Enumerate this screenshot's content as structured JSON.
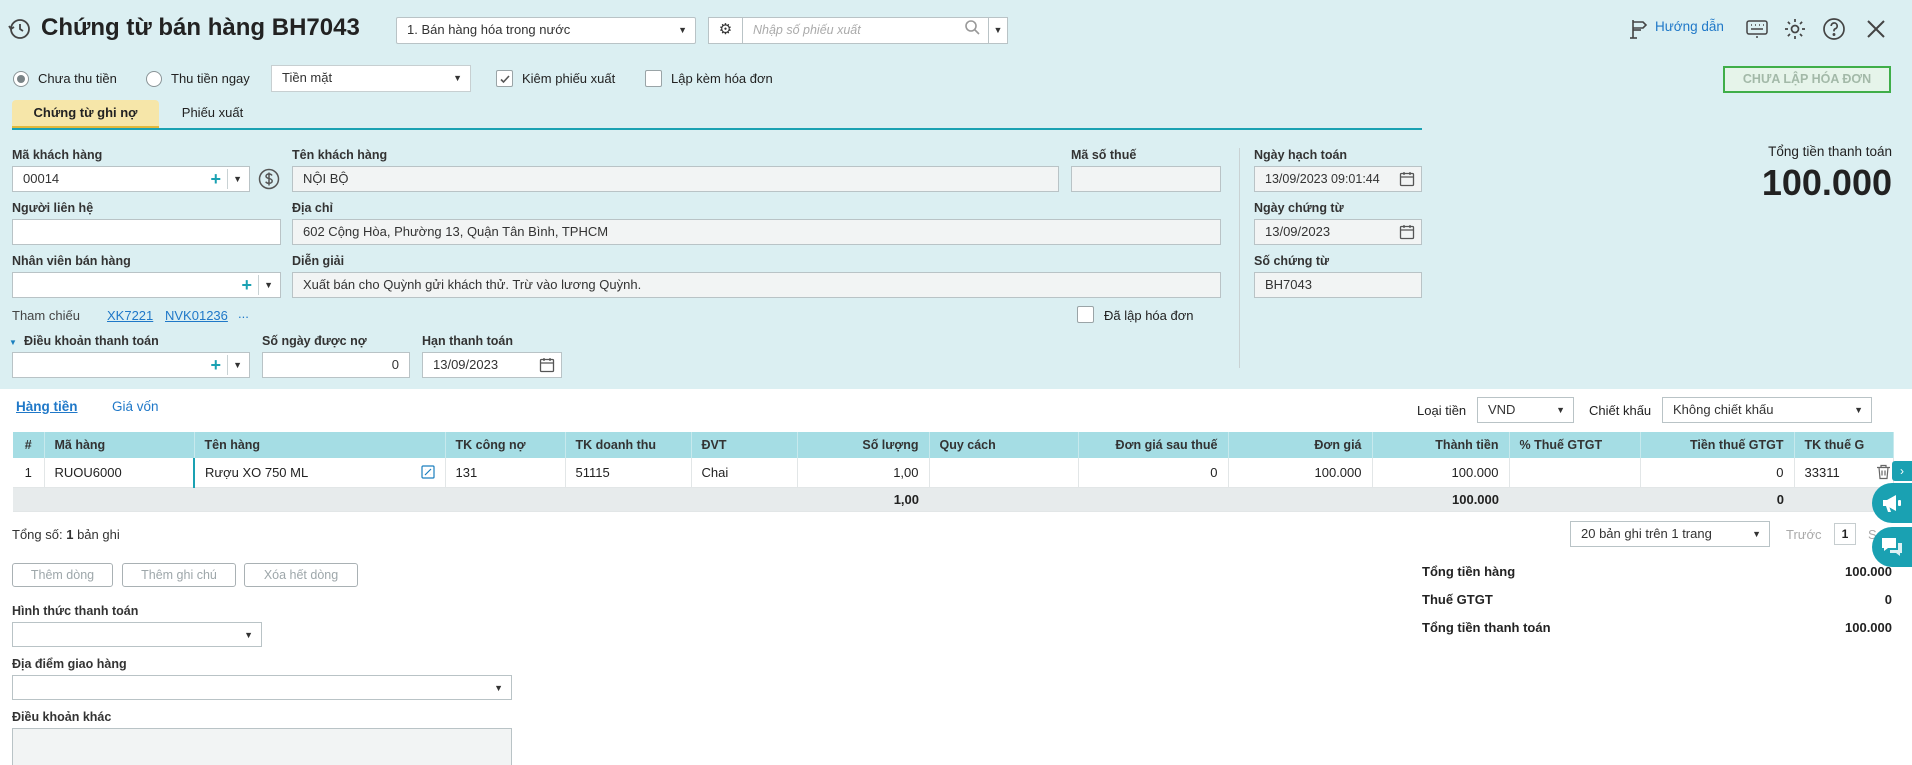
{
  "header": {
    "title": "Chứng từ bán hàng BH7043",
    "type_select": "1. Bán hàng hóa trong nước",
    "search_placeholder": "Nhập số phiếu xuất",
    "guide_label": "Hướng dẫn"
  },
  "options": {
    "unpaid_label": "Chưa thu tiền",
    "paid_label": "Thu tiền ngay",
    "payment_method": "Tiền mặt",
    "export_slip_label": "Kiêm phiếu xuất",
    "invoice_label": "Lập kèm hóa đơn",
    "status_badge": "CHƯA LẬP HÓA ĐƠN"
  },
  "tabs": [
    "Chứng từ ghi nợ",
    "Phiếu xuất"
  ],
  "form": {
    "customer_code_label": "Mã khách hàng",
    "customer_code": "00014",
    "customer_name_label": "Tên khách hàng",
    "customer_name": "NỘI BỘ",
    "tax_code_label": "Mã số thuế",
    "tax_code": "",
    "contact_label": "Người liên hệ",
    "contact": "",
    "address_label": "Địa chỉ",
    "address": "602 Cộng Hòa, Phường 13, Quận Tân Bình, TPHCM",
    "salesperson_label": "Nhân viên bán hàng",
    "salesperson": "",
    "description_label": "Diễn giải",
    "description": "Xuất bán cho Quỳnh gửi khách thử. Trừ vào lương Quỳnh.",
    "ref_label": "Tham chiếu",
    "ref_1": "XK7221",
    "ref_2": "NVK01236",
    "ref_more": "...",
    "invoiced_label": "Đã lập hóa đơn",
    "payment_terms_label": "Điều khoản thanh toán",
    "payment_terms": "",
    "credit_days_label": "Số ngày được nợ",
    "credit_days": "0",
    "due_date_label": "Hạn thanh toán",
    "due_date": "13/09/2023",
    "posting_date_label": "Ngày hạch toán",
    "posting_date": "13/09/2023 09:01:44",
    "voucher_date_label": "Ngày chứng từ",
    "voucher_date": "13/09/2023",
    "voucher_no_label": "Số chứng từ",
    "voucher_no": "BH7043",
    "total_payment_label": "Tổng tiền thanh toán",
    "total_payment": "100.000"
  },
  "detail": {
    "tab_goods": "Hàng tiền",
    "tab_cost": "Giá vốn",
    "currency_label": "Loại tiền",
    "currency": "VND",
    "discount_label": "Chiết khấu",
    "discount": "Không chiết khấu",
    "columns": [
      "#",
      "Mã hàng",
      "Tên hàng",
      "TK công nợ",
      "TK doanh thu",
      "ĐVT",
      "Số lượng",
      "Quy cách",
      "Đơn giá sau thuế",
      "Đơn giá",
      "Thành tiền",
      "% Thuế GTGT",
      "Tiền thuế GTGT",
      "TK thuế G"
    ],
    "row": {
      "no": "1",
      "code": "RUOU6000",
      "name": "Rượu XO 750 ML",
      "ar_account": "131",
      "rev_account": "51115",
      "unit": "Chai",
      "qty": "1,00",
      "spec": "",
      "price_after_tax": "0",
      "price": "100.000",
      "amount": "100.000",
      "vat_rate": "",
      "vat_amount": "0",
      "vat_account": "33311"
    },
    "totals": {
      "qty": "1,00",
      "amount": "100.000",
      "vat_amount": "0"
    },
    "record_count_prefix": "Tổng số:",
    "record_count": "1",
    "record_count_suffix": "bản ghi",
    "page_size": "20 bản ghi trên 1 trang",
    "prev_label": "Trước",
    "page_no": "1",
    "next_label": "S"
  },
  "actions": {
    "add_row": "Thêm dòng",
    "add_note": "Thêm ghi chú",
    "delete_all": "Xóa hết dòng"
  },
  "bottom": {
    "payment_form_label": "Hình thức thanh toán",
    "delivery_label": "Địa điểm giao hàng",
    "other_terms_label": "Điều khoản khác"
  },
  "summary": {
    "goods_label": "Tổng tiền hàng",
    "goods_value": "100.000",
    "vat_label": "Thuế GTGT",
    "vat_value": "0",
    "total_label": "Tổng tiền thanh toán",
    "total_value": "100.000"
  },
  "colors": {
    "accent": "#1aa1b2",
    "header_bg": "#dbeff2",
    "grid_header": "#a5dde4",
    "badge": "#3fae49"
  }
}
